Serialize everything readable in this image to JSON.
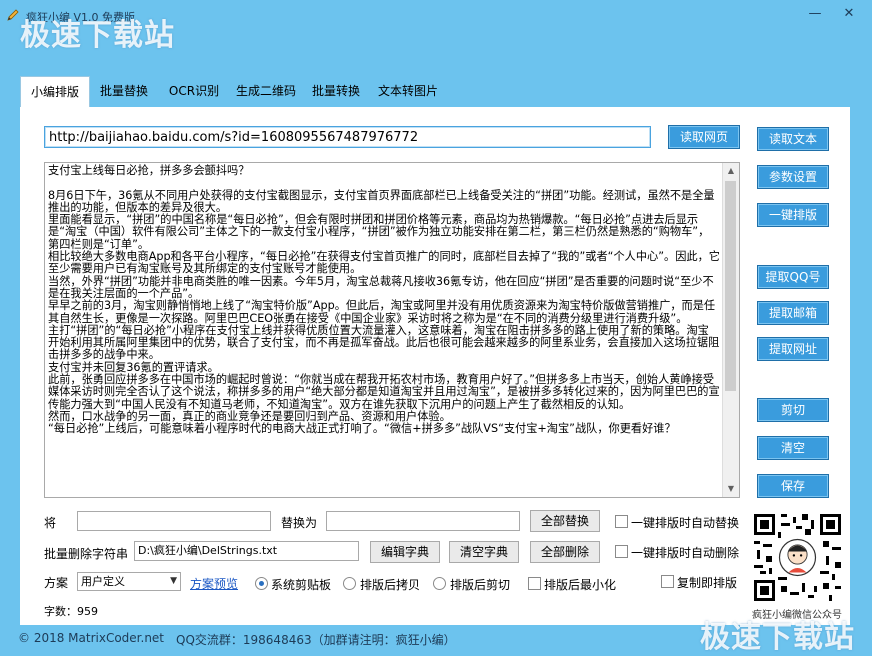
{
  "window": {
    "title": "疯狂小编 V1.0 免费版",
    "watermark": "极速下载站",
    "controls": {
      "minimize": "—",
      "close": "✕"
    }
  },
  "tabs": [
    "小编排版",
    "批量替换",
    "OCR识别",
    "生成二维码",
    "批量转换",
    "文本转图片"
  ],
  "url": {
    "value": "http://baijiahao.baidu.com/s?id=1608095567487976772",
    "fetch_label": "读取网页"
  },
  "editor": {
    "content": "支付宝上线每日必抢，拼多多会颤抖吗？\n\n8月6日下午，36氪从不同用户处获得的支付宝截图显示，支付宝首页界面底部栏已上线备受关注的“拼团”功能。经测试，虽然不是全量推出的功能，但版本的差异及很大。\n里面能看显示，“拼团”的中国名称是“每日必抢”，但会有限时拼团和拼团价格等元素，商品均为热销爆款。“每日必抢”点进去后显示是“淘宝（中国）软件有限公司”主体之下的一款支付宝小程序，“拼团”被作为独立功能安排在第二栏，第三栏仍然是熟悉的“购物车”，第四栏则是“订单”。\n相比较绝大多数电商App和各平台小程序，“每日必抢”在获得支付宝首页推广的同时，底部栏目去掉了“我的”或者“个人中心”。因此，它至少需要用户已有淘宝账号及其所绑定的支付宝账号才能使用。\n当然，外界“拼团”功能并非电商类胜的唯一因素。今年5月，淘宝总裁蒋凡接收36氪专访，他在回应“拼团”是否重要的问题时说“至少不是在我关注层面的一个产品”。\n早早之前的3月，淘宝则静悄悄地上线了“淘宝特价版”App。但此后，淘宝或阿里并没有用优质资源来为淘宝特价版做营销推广，而是任其自然生长，更像是一次探路。阿里巴巴CEO张勇在接受《中国企业家》采访时将之称为是“在不同的消费分级里进行消费升级”。\n主打“拼团”的“每日必抢”小程序在支付宝上线并获得优质位置大流量灌入，这意味着，淘宝在阻击拼多多的路上使用了新的策略。淘宝开始利用其所属阿里集团中的优势，联合了支付宝，而不再是孤军奋战。此后也很可能会越来越多的阿里系业务，会直接加入这场拉锯阻击拼多多的战争中来。\n支付宝并未回复36氪的置评请求。\n此前，张勇回应拼多多在中国市场的崛起时曾说：“你就当成在帮我开拓农村市场，教育用户好了。”但拼多多上市当天，创始人黄峥接受媒体采访时则完全否认了这个说法，称拼多多的用户“绝大部分都是知道淘宝并且用过淘宝”，是被拼多多转化过来的，因为阿里巴巴的宣传能力强大到“中国人民没有不知道马老师，不知道淘宝”。双方在谁先获取下沉用户的问题上产生了截然相反的认知。\n然而，口水战争的另一面，真正的商业竞争还是要回归到产品、资源和用户体验。\n“每日必抢”上线后，可能意味着小程序时代的电商大战正式打响了。“微信+拼多多”战队VS“支付宝+淘宝”战队，你更看好谁？"
  },
  "right_buttons": {
    "read_text": "读取文本",
    "params": "参数设置",
    "one_click_format": "一键排版",
    "extract_qq": "提取QQ号",
    "extract_email": "提取邮箱",
    "extract_url": "提取网址",
    "cut": "剪切",
    "clear": "清空",
    "save": "保存"
  },
  "replace": {
    "label_from": "将",
    "label_to": "替换为",
    "replace_all": "全部替换",
    "auto_replace": "一键排版时自动替换"
  },
  "delete": {
    "label": "批量删除字符串",
    "path": "D:\\疯狂小编\\DelStrings.txt",
    "edit_dict": "编辑字典",
    "clear_dict": "清空字典",
    "delete_all": "全部删除",
    "auto_delete": "一键排版时自动删除"
  },
  "scheme": {
    "label": "方案",
    "selected": "用户定义",
    "preview_link": "方案预览",
    "opt_clipboard": "系统剪贴板",
    "opt_copy_after": "排版后拷贝",
    "opt_cut_after": "排版后剪切",
    "opt_minimize": "排版后最小化",
    "opt_copy_instant": "复制即排版"
  },
  "char_count": "字数：959",
  "qr_caption": "疯狂小编微信公众号",
  "status": {
    "copyright": "© 2018 MatrixCoder.net",
    "qq_group": "QQ交流群：198648463（加群请注明：疯狂小编）"
  },
  "colors": {
    "window_bg": "#6cc3ee",
    "accent_button": "#3a9cdd",
    "link": "#1a57c4"
  }
}
